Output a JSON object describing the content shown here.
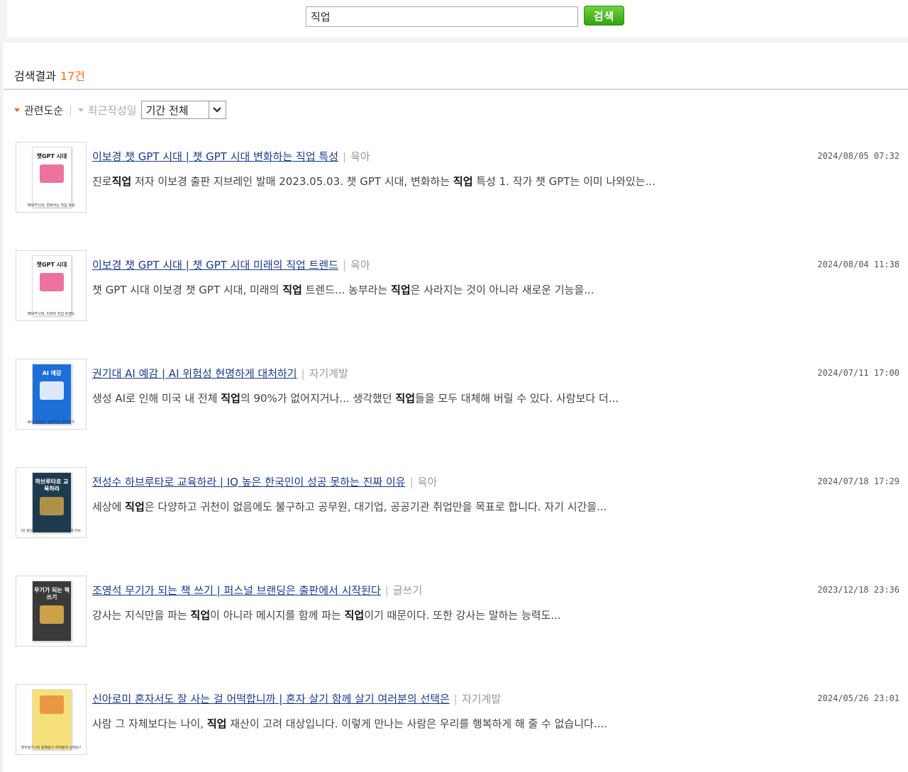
{
  "search": {
    "query": "직업",
    "button_label": "검색"
  },
  "summary": {
    "label": "검색결과",
    "count": "17건"
  },
  "sort": {
    "relevance": "관련도순",
    "separator": "|",
    "recent": "최근작성일",
    "period_value": "기간 전체"
  },
  "results": [
    {
      "title": "이보경 챗 GPT 시대 | 챗 GPT 시대 변화하는 직업 특성",
      "category": "육아",
      "date": "2024/08/05 07:32",
      "snippet_parts": [
        "진로",
        "직업",
        " 저자 이보경 출판 지브레인 발매 2023.05.03. 챗 GPT 시대, 변화하는 ",
        "직업",
        " 특성 1. 작가 챗 GPT는 이미 나와있는..."
      ],
      "thumb_title": "챗GPT 시대",
      "thumb_caption": "챗GPT시대, 변화하는 직업 특성",
      "thumb_colors": [
        "#ffffff",
        "#e85a8c"
      ]
    },
    {
      "title": "이보경 챗 GPT 시대 | 챗 GPT 시대 미래의 직업 트렌드",
      "category": "육아",
      "date": "2024/08/04 11:38",
      "snippet_parts": [
        "챗 GPT 시대 이보경 챗 GPT 시대, 미래의 ",
        "직업",
        " 트렌드... 농부라는 ",
        "직업",
        "은 사라지는 것이 아니라 새로운 기능을..."
      ],
      "thumb_title": "챗GPT 시대",
      "thumb_caption": "챗GPT시대, 미래의 직업 트렌드",
      "thumb_colors": [
        "#ffffff",
        "#e85a8c"
      ]
    },
    {
      "title": "권기대 AI 예감 | AI 위험성 현명하게 대처하기",
      "category": "자기계발",
      "date": "2024/07/11 17:00",
      "snippet_parts": [
        "생성 AI로 인해 미국 내 전체 ",
        "직업",
        "의 90%가 없어지거나... 생각했던 ",
        "직업",
        "들을 모두 대체해 버릴 수 있다. 사람보다 더..."
      ],
      "thumb_title": "AI 예감",
      "thumb_caption": "AI의 위험성, 현명하게 대처하기",
      "thumb_colors": [
        "#1d6fd8",
        "#ffffff"
      ]
    },
    {
      "title": "전성수 하브루타로 교육하라 | IQ 높은 한국인이 성공 못하는 진짜 이유",
      "category": "육아",
      "date": "2024/07/18 17:29",
      "snippet_parts": [
        "세상에 ",
        "직업",
        "은 다양하고 귀천이 없음에도 불구하고 공무원, 대기업, 공공기관 취업만을 목표로 합니다. 자기 시간을..."
      ],
      "thumb_title": "하브루타로 교육하라",
      "thumb_caption": "IQ 높은 한국인이 성공 못하는 진짜 이유",
      "thumb_colors": [
        "#1e3a4e",
        "#c9a24a"
      ]
    },
    {
      "title": "조영석 무기가 되는 책 쓰기 | 퍼스널 브랜딩은 출판에서 시작된다",
      "category": "글쓰기",
      "date": "2023/12/18 23:36",
      "snippet_parts": [
        "강사는 지식만을 파는 ",
        "직업",
        "이 아니라 메시지를 함께 파는 ",
        "직업",
        "이기 때문이다. 또한 강사는 말하는 능력도..."
      ],
      "thumb_title": "무기가 되는 책 쓰기",
      "thumb_caption": "",
      "thumb_colors": [
        "#3a3a3a",
        "#e8b44a"
      ]
    },
    {
      "title": "신아로미 혼자서도 잘 사는 걸 어떡합니까 | 혼자 살기 함께 살기 여러분의 선택은",
      "category": "자기계발",
      "date": "2024/05/26 23:01",
      "snippet_parts": [
        "사람 그 자체보다는 나이, ",
        "직업",
        " 재산이 고려 대상입니다. 이렇게 만나는 사람은 우리를 행복하게 해 줄 수 없습니다...."
      ],
      "thumb_title": "",
      "thumb_caption": "혼자살기 VS 함께살기 여러분의 선택은?",
      "thumb_colors": [
        "#f5e07a",
        "#e88a3a"
      ]
    }
  ]
}
